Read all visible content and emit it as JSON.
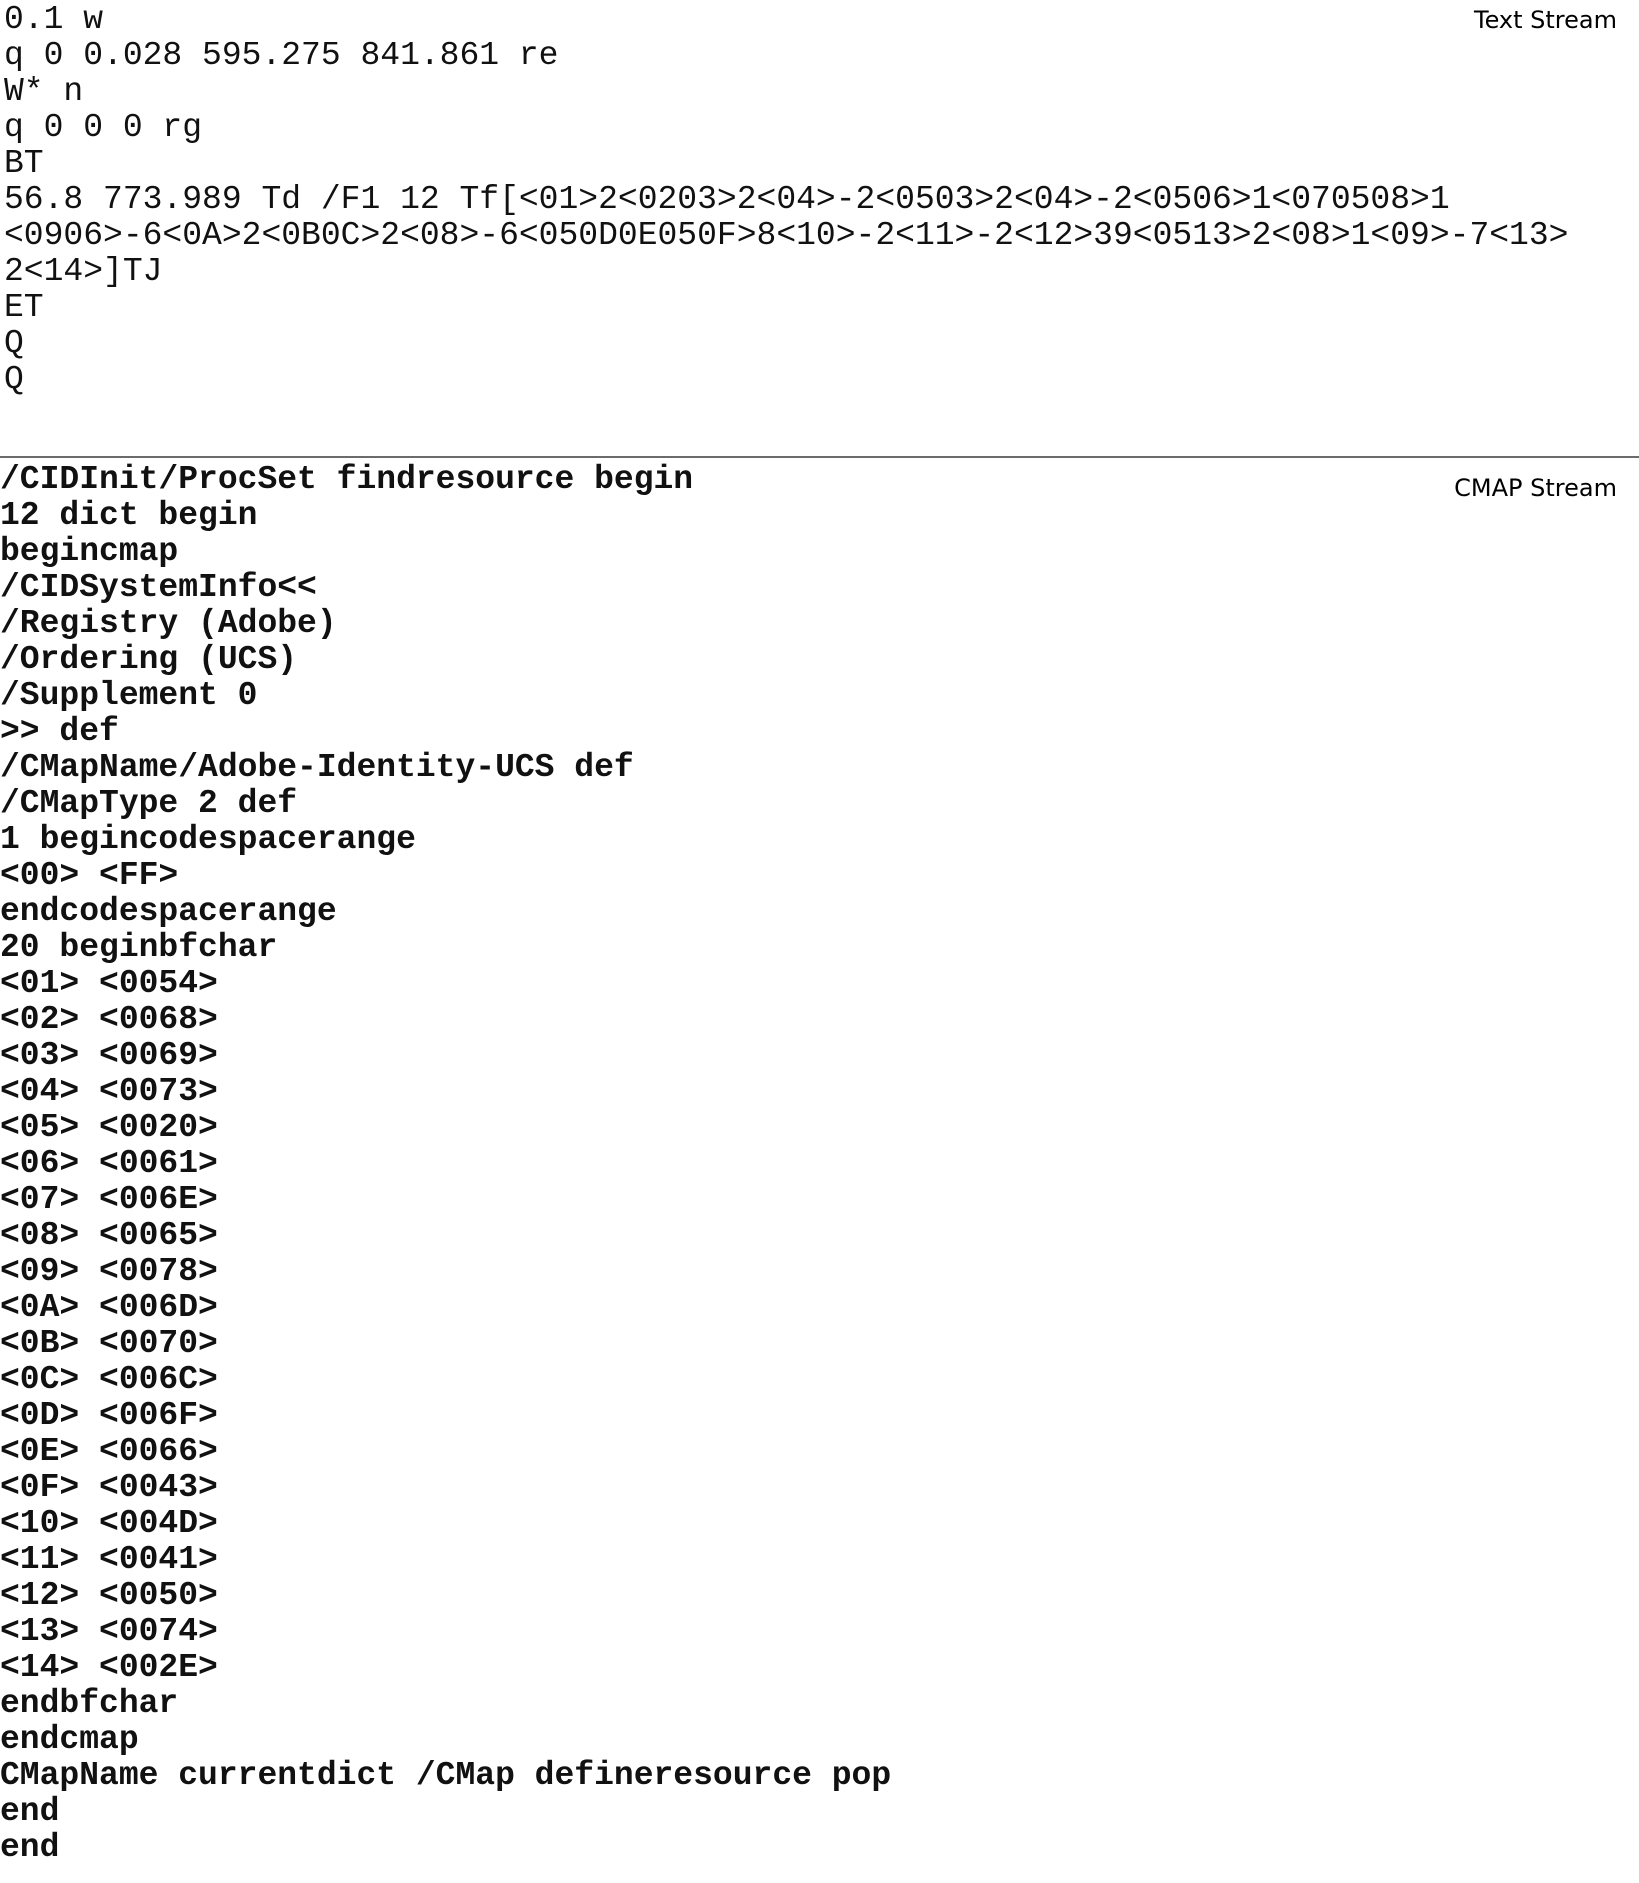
{
  "text_stream": {
    "label": "Text Stream",
    "lines": [
      "0.1 w",
      "q 0 0.028 595.275 841.861 re",
      "W* n",
      "q 0 0 0 rg",
      "BT",
      "56.8 773.989 Td /F1 12 Tf[<01>2<0203>2<04>-2<0503>2<04>-2<0506>1<070508>1",
      "<0906>-6<0A>2<0B0C>2<08>-6<050D0E050F>8<10>-2<11>-2<12>39<0513>2<08>1<09>-7<13>",
      "2<14>]TJ",
      "ET",
      "Q",
      "Q"
    ]
  },
  "cmap_stream": {
    "label": "CMAP Stream",
    "lines": [
      "/CIDInit/ProcSet findresource begin",
      "12 dict begin",
      "begincmap",
      "/CIDSystemInfo<<",
      "/Registry (Adobe)",
      "/Ordering (UCS)",
      "/Supplement 0",
      ">> def",
      "/CMapName/Adobe-Identity-UCS def",
      "/CMapType 2 def",
      "1 begincodespacerange",
      "<00> <FF>",
      "endcodespacerange",
      "20 beginbfchar",
      "<01> <0054>",
      "<02> <0068>",
      "<03> <0069>",
      "<04> <0073>",
      "<05> <0020>",
      "<06> <0061>",
      "<07> <006E>",
      "<08> <0065>",
      "<09> <0078>",
      "<0A> <006D>",
      "<0B> <0070>",
      "<0C> <006C>",
      "<0D> <006F>",
      "<0E> <0066>",
      "<0F> <0043>",
      "<10> <004D>",
      "<11> <0041>",
      "<12> <0050>",
      "<13> <0074>",
      "<14> <002E>",
      "endbfchar",
      "endcmap",
      "CMapName currentdict /CMap defineresource pop",
      "end",
      "end"
    ]
  },
  "colors": {
    "background": "#ffffff",
    "text": "#111111",
    "divider": "#6b6b6b"
  }
}
